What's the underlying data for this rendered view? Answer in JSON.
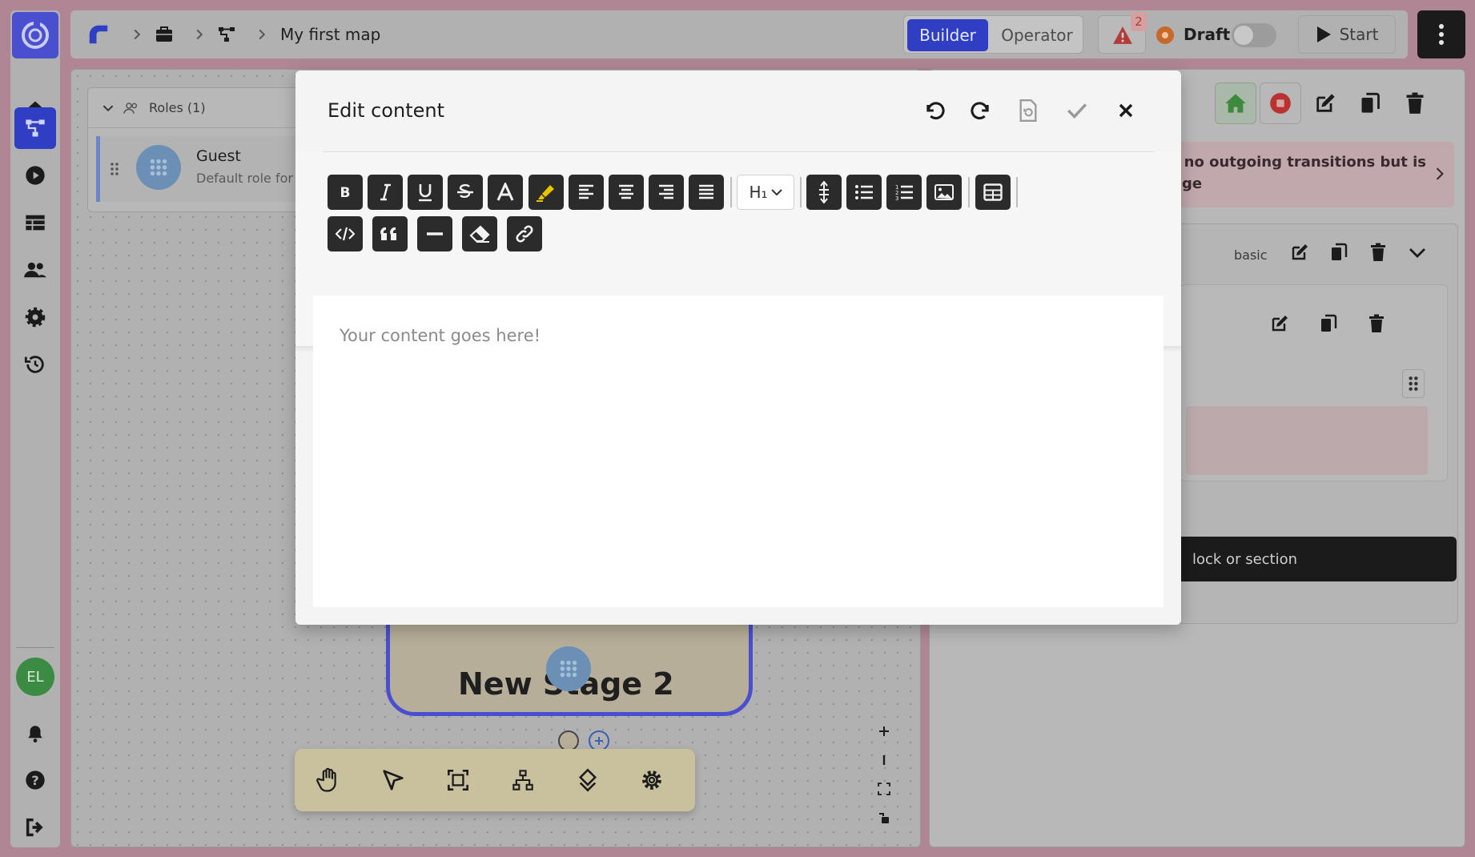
{
  "colors": {
    "accent": "#2f3ec3",
    "brand": "#4a4fcf",
    "warning": "#b23c3c",
    "draft": "#c8692b",
    "dark": "#1b1b1b"
  },
  "sidebar": {
    "avatar_initials": "EL",
    "items": [
      {
        "name": "home",
        "icon": "home-icon"
      },
      {
        "name": "maps",
        "icon": "flowchart-icon",
        "active": true
      },
      {
        "name": "run",
        "icon": "play-circle-icon"
      },
      {
        "name": "tables",
        "icon": "table-icon"
      },
      {
        "name": "users",
        "icon": "users-icon"
      },
      {
        "name": "settings",
        "icon": "gear-icon"
      },
      {
        "name": "history",
        "icon": "history-icon"
      }
    ],
    "bottom_items": [
      {
        "name": "notifications",
        "icon": "bell-icon"
      },
      {
        "name": "help",
        "icon": "help-icon"
      },
      {
        "name": "logout",
        "icon": "logout-icon"
      }
    ]
  },
  "topbar": {
    "breadcrumb_title": "My first map",
    "mode_builder": "Builder",
    "mode_operator": "Operator",
    "warning_count": "2",
    "status": "Draft",
    "start_label": "Start"
  },
  "canvas": {
    "roles_header": "Roles (1)",
    "role_name": "Guest",
    "role_desc": "Default role for p",
    "stage_title": "New Stage 2"
  },
  "right_panel": {
    "notice_line1": "no outgoing transitions but is",
    "notice_line2": "ge",
    "section_type": "basic",
    "add_label": "lock or section"
  },
  "modal": {
    "title": "Edit content",
    "heading_select": "H₁",
    "placeholder": "Your content goes here!"
  }
}
